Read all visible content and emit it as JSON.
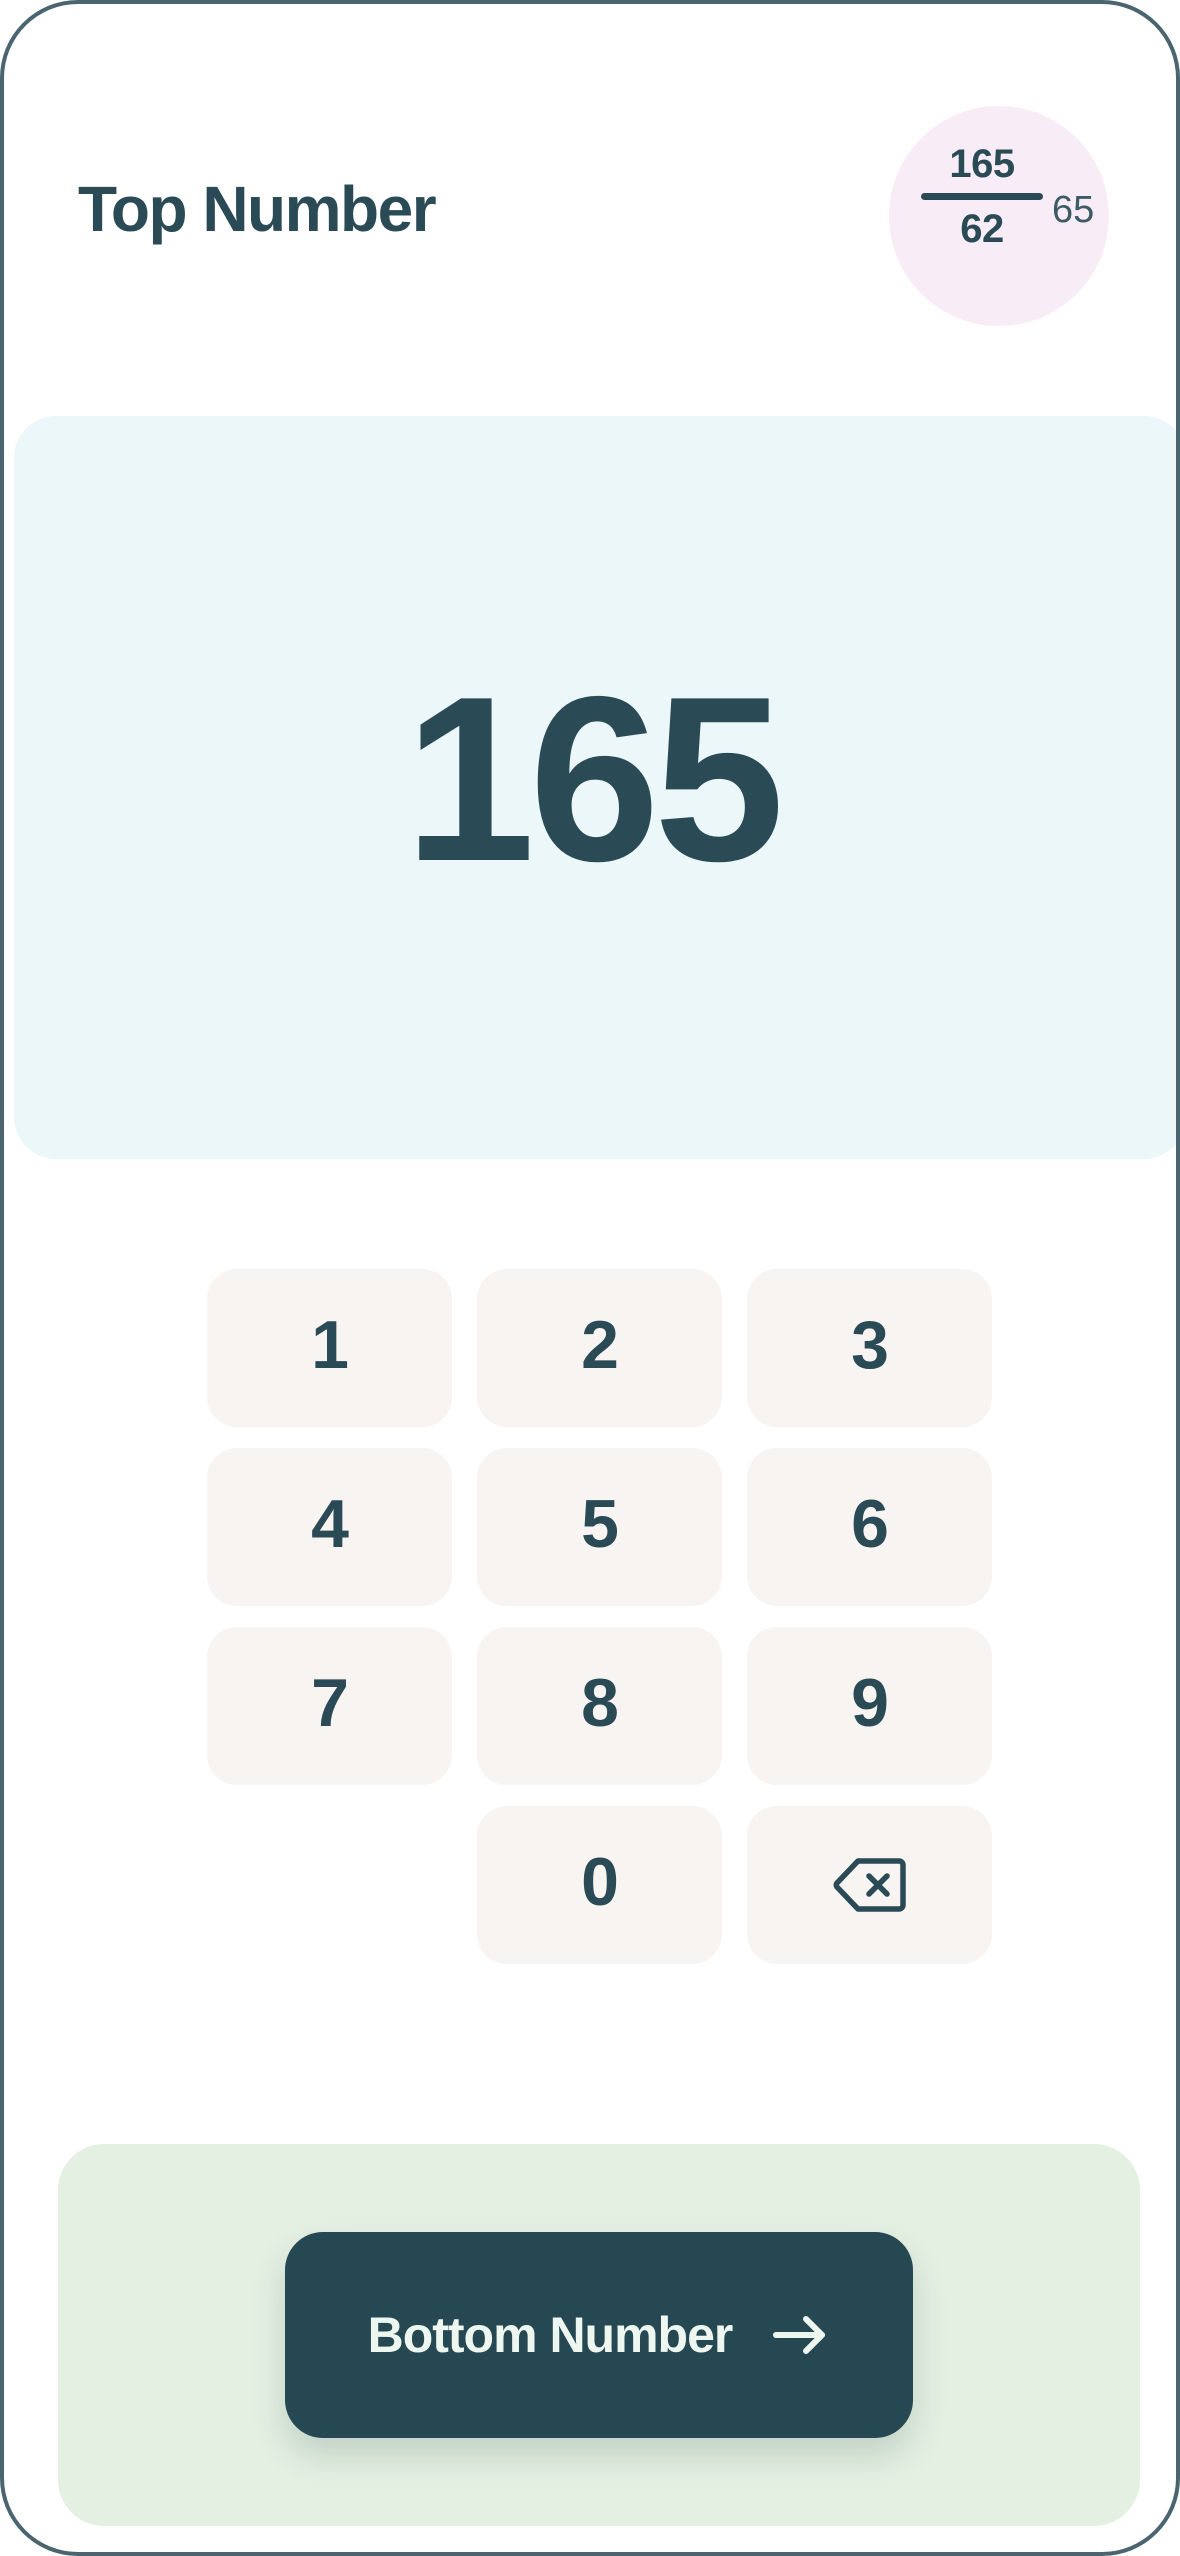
{
  "header": {
    "title": "Top Number",
    "badge": {
      "numerator": "165",
      "denominator": "62",
      "remainder": "65",
      "circle_color": "#f8ecf6",
      "text_color": "#2a4a55"
    }
  },
  "display": {
    "value": "165",
    "background_color": "#ebf7f8",
    "text_color": "#2a4a55"
  },
  "keypad": {
    "key_background_color": "#f8f4f1",
    "key_text_color": "#2a4a55",
    "rows": [
      [
        {
          "label": "1",
          "name": "key-1"
        },
        {
          "label": "2",
          "name": "key-2"
        },
        {
          "label": "3",
          "name": "key-3"
        }
      ],
      [
        {
          "label": "4",
          "name": "key-4"
        },
        {
          "label": "5",
          "name": "key-5"
        },
        {
          "label": "6",
          "name": "key-6"
        }
      ],
      [
        {
          "label": "7",
          "name": "key-7"
        },
        {
          "label": "8",
          "name": "key-8"
        },
        {
          "label": "9",
          "name": "key-9"
        }
      ],
      [
        {
          "label": "0",
          "name": "key-0"
        },
        {
          "label": "",
          "name": "key-backspace",
          "icon": "backspace-icon"
        }
      ]
    ]
  },
  "bottom": {
    "panel_color": "#e4f0e2",
    "cta_label": "Bottom Number",
    "cta_icon": "arrow-right-icon",
    "cta_background_color": "#264853",
    "cta_text_color": "#eef7ef"
  },
  "theme": {
    "frame_color": "#4a6570",
    "screen_background": "#ffffff",
    "accent_dark": "#2a4a55"
  }
}
